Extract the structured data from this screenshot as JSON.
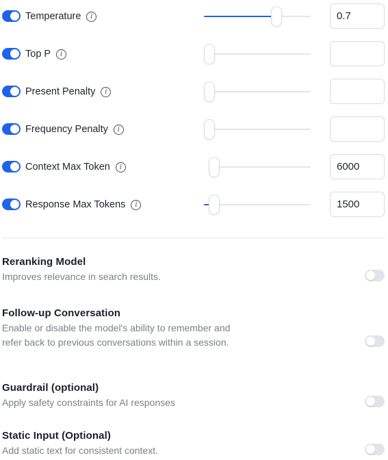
{
  "parameters": [
    {
      "label": "Temperature",
      "enabled": true,
      "value": "0.7",
      "level": 0.7
    },
    {
      "label": "Top P",
      "enabled": true,
      "value": "",
      "level": 0.0
    },
    {
      "label": "Present Penalty",
      "enabled": true,
      "value": "",
      "level": 0.0
    },
    {
      "label": "Frequency Penalty",
      "enabled": true,
      "value": "",
      "level": 0.0
    },
    {
      "label": "Context Max Token",
      "enabled": true,
      "value": "6000",
      "level": 0.0
    },
    {
      "label": "Response Max Tokens",
      "enabled": true,
      "value": "1500",
      "level": 0.05
    }
  ],
  "settings": [
    {
      "title": "Reranking Model",
      "description": "Improves relevance in search results.",
      "enabled": false
    },
    {
      "title": "Follow-up Conversation",
      "description": "Enable or disable the model's ability to remember and refer back to previous conversations within a session.",
      "enabled": false
    },
    {
      "title": "Guardrail (optional)",
      "description": "Apply safety constraints for AI responses",
      "enabled": false
    },
    {
      "title": "Static Input (Optional)",
      "description": "Add static text for consistent context.",
      "enabled": false
    }
  ],
  "info_icon_glyph": "i",
  "icons": {
    "info": "info-icon"
  },
  "colors": {
    "accent": "#1f63e8",
    "toggle_off": "#e2e4e9",
    "muted_text": "#7a7f8a"
  }
}
